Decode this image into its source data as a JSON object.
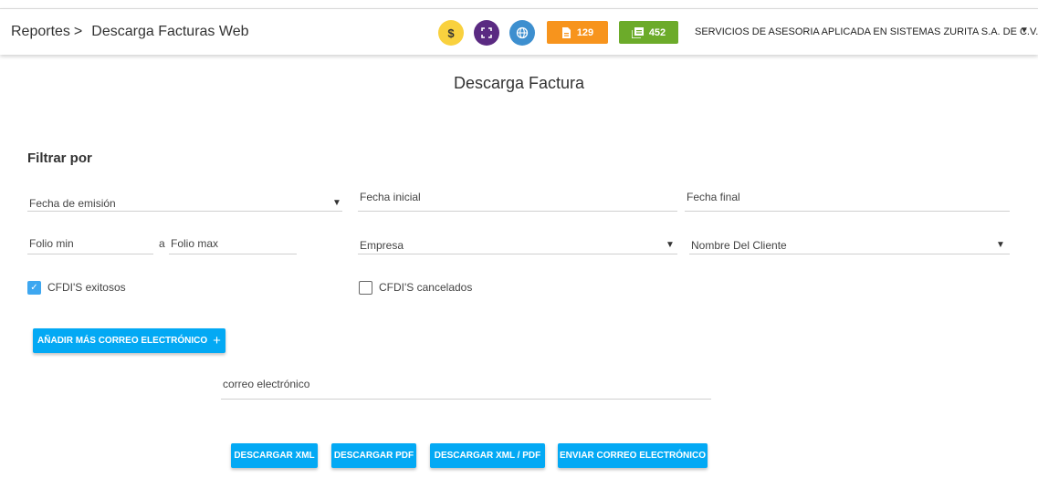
{
  "header": {
    "breadcrumb_root": "Reportes",
    "breadcrumb_separator": ">",
    "breadcrumb_current": "Descarga Facturas Web",
    "circle_balance_label": "$",
    "badge_documents_count": "129",
    "badge_stamps_count": "452",
    "company_name": "SERVICIOS DE ASESORIA APLICADA EN SISTEMAS ZURITA S.A. DE C.V. .",
    "colors": {
      "balance": "#f9d13e",
      "scan": "#5a2a82",
      "web": "#3d8fcf",
      "documents": "#f7941d",
      "stamps": "#6cab2a"
    }
  },
  "page": {
    "title": "Descarga Factura",
    "filter_heading": "Filtrar por"
  },
  "filters": {
    "date_type_value": "Fecha de emisión",
    "start_date_placeholder": "Fecha inicial",
    "end_date_placeholder": "Fecha final",
    "folio_min_placeholder": "Folio min",
    "folio_separator": "a",
    "folio_max_placeholder": "Folio max",
    "company_placeholder": "Empresa",
    "client_placeholder": "Nombre Del Cliente",
    "cfdi_success_label": "CFDI'S exitosos",
    "cfdi_success_checked": true,
    "cfdi_cancelled_label": "CFDI'S cancelados",
    "cfdi_cancelled_checked": false
  },
  "email": {
    "add_button_label": "AÑADIR MÁS CORREO ELECTRÓNICO",
    "add_button_icon": "+",
    "email_placeholder": "correo electrónico"
  },
  "actions": {
    "download_xml": "DESCARGAR XML",
    "download_pdf": "DESCARGAR PDF",
    "download_xml_pdf": "DESCARGAR XML / PDF",
    "send_email": "ENVIAR CORREO ELECTRÓNICO",
    "button_color": "#03a9f4"
  }
}
